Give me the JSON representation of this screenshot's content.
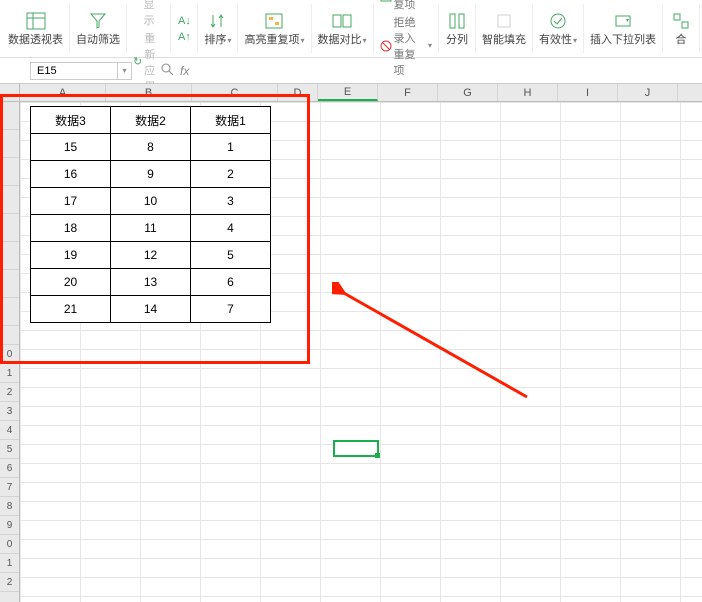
{
  "ribbon": {
    "pivot": "数据透视表",
    "filter": "自动筛选",
    "show_all": "全部显示",
    "reapply": "重新应用",
    "sort": "排序",
    "highlight_dup": "高亮重复项",
    "data_compare": "数据对比",
    "delete_dup": "删除重复项",
    "reject_dup": "拒绝录入重复项",
    "split_col": "分列",
    "smart_fill": "智能填充",
    "validity": "有效性",
    "insert_dropdown": "插入下拉列表",
    "consolidate": "合"
  },
  "name_box": "E15",
  "formula": {
    "fx": "fx"
  },
  "columns": [
    "A",
    "B",
    "C",
    "D",
    "E",
    "F",
    "G",
    "H",
    "I",
    "J"
  ],
  "rows_top_blank": [
    "",
    "",
    "",
    "",
    "",
    "",
    "",
    ""
  ],
  "rows_bottom": [
    "",
    "0",
    "1",
    "2",
    "3",
    "4",
    "5",
    "6",
    "7",
    "8",
    "9",
    "0",
    "1",
    "2"
  ],
  "table": {
    "headers": [
      "数据3",
      "数据2",
      "数据1"
    ],
    "rows": [
      [
        "15",
        "8",
        "1"
      ],
      [
        "16",
        "9",
        "2"
      ],
      [
        "17",
        "10",
        "3"
      ],
      [
        "18",
        "11",
        "4"
      ],
      [
        "19",
        "12",
        "5"
      ],
      [
        "20",
        "13",
        "6"
      ],
      [
        "21",
        "14",
        "7"
      ]
    ]
  },
  "active_cell": {
    "col": "E",
    "row": 15
  }
}
